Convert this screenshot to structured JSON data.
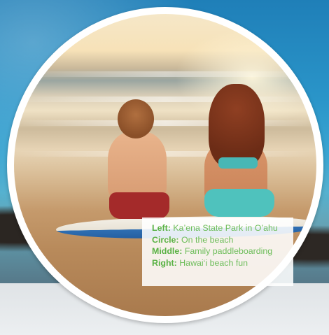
{
  "caption": {
    "lines": [
      {
        "key": "Left:",
        "value": "Ka’ena State Park in O’ahu"
      },
      {
        "key": "Circle:",
        "value": "On the beach"
      },
      {
        "key": "Middle:",
        "value": "Family paddleboarding"
      },
      {
        "key": "Right:",
        "value": "Hawai‘i beach fun"
      }
    ]
  },
  "colors": {
    "caption_text": "#5bb346",
    "surfboard_deck": "#f3efe6",
    "surfboard_rail": "#2f6fb3"
  }
}
